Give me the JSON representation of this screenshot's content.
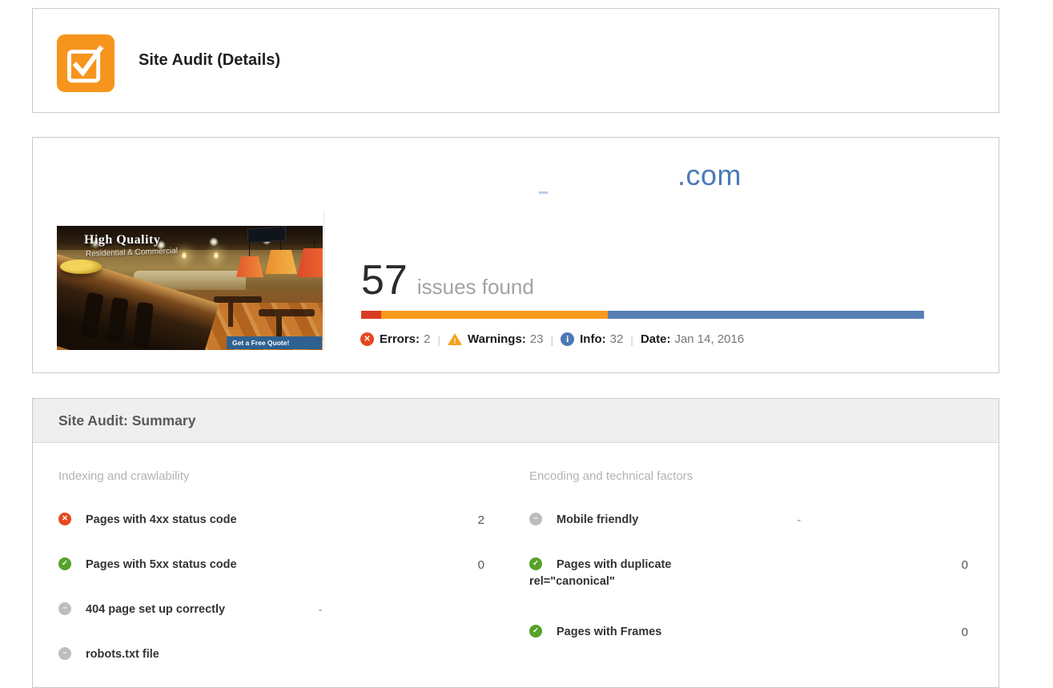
{
  "header": {
    "title": "Site Audit (Details)",
    "icon": "checked-checkbox",
    "icon_color": "#f7941e"
  },
  "overview": {
    "domain_suffix": ".com",
    "domain_color": "#4a7ab8",
    "issues_count": "57",
    "issues_label": "issues found",
    "stats": [
      {
        "type": "error",
        "label": "Errors:",
        "value": "2"
      },
      {
        "type": "warning",
        "label": "Warnings:",
        "value": "23"
      },
      {
        "type": "info",
        "label": "Info:",
        "value": "32"
      }
    ],
    "date": {
      "label": "Date:",
      "value": "Jan 14, 2016"
    },
    "bar_colors": {
      "error": "#dc3b21",
      "warning": "#f89a1c",
      "info": "#577fb4"
    },
    "thumbnail": {
      "headline": "High Quality",
      "subheadline": "Residential & Commercial",
      "cta": "Get a Free Quote!"
    }
  },
  "summary": {
    "title": "Site Audit: Summary",
    "columns": [
      {
        "heading": "Indexing and crawlability",
        "items": [
          {
            "status": "error",
            "label": "Pages with 4xx status code",
            "value": "2"
          },
          {
            "status": "ok",
            "label": "Pages with 5xx status code",
            "value": "0"
          },
          {
            "status": "na",
            "label": "404 page set up correctly",
            "value": "-"
          },
          {
            "status": "na",
            "label": "robots.txt file",
            "value": ""
          }
        ]
      },
      {
        "heading": "Encoding and technical factors",
        "items": [
          {
            "status": "na",
            "label": "Mobile friendly",
            "value": "-"
          },
          {
            "status": "ok",
            "label": "Pages with duplicate rel=\"canonical\"",
            "value": "0",
            "wrap": true
          },
          {
            "status": "ok",
            "label": "Pages with Frames",
            "value": "0"
          }
        ]
      }
    ]
  }
}
